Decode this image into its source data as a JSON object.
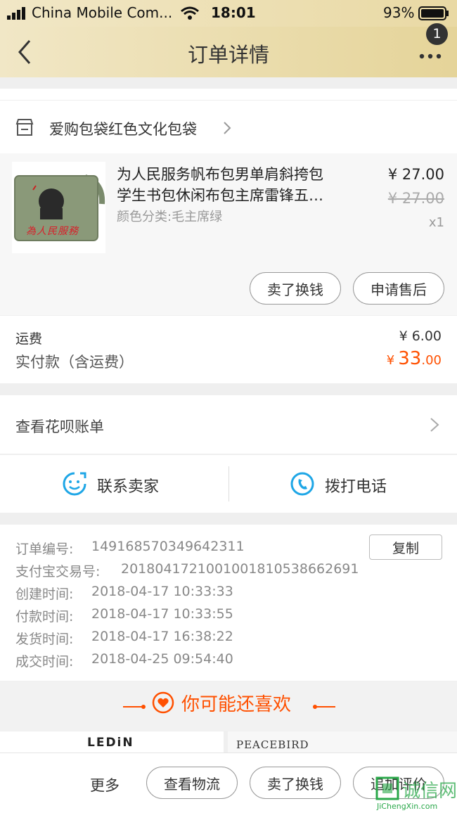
{
  "status": {
    "carrier": "China Mobile Com...",
    "time": "18:01",
    "battery": "93%"
  },
  "nav": {
    "title": "订单详情",
    "badge": "1"
  },
  "shop": {
    "name": "爱购包袋红色文化包袋"
  },
  "product": {
    "title_line1": "为人民服务帆布包男单肩斜挎包",
    "title_line2": "学生书包休闲布包主席雷锋五…",
    "spec": "颜色分类:毛主席绿",
    "price": "¥ 27.00",
    "original_price": "¥ 27.00",
    "quantity": "x1",
    "image_text": "為人民服務",
    "actions": [
      "卖了换钱",
      "申请售后"
    ]
  },
  "payment": {
    "shipping_label": "运费",
    "shipping_value": "¥ 6.00",
    "total_label": "实付款（含运费）",
    "total_currency": "¥",
    "total_int": "33",
    "total_dec": ".00"
  },
  "huabei": {
    "label": "查看花呗账单"
  },
  "contact": {
    "seller": "联系卖家",
    "phone": "拨打电话"
  },
  "order_info": {
    "copy_button": "复制",
    "rows": [
      {
        "label": "订单编号:",
        "value": "149168570349642311"
      },
      {
        "label": "支付宝交易号:",
        "value": "2018041721001001810538662691"
      },
      {
        "label": "创建时间:",
        "value": "2018-04-17 10:33:33"
      },
      {
        "label": "付款时间:",
        "value": "2018-04-17 10:33:55"
      },
      {
        "label": "发货时间:",
        "value": "2018-04-17 16:38:22"
      },
      {
        "label": "成交时间:",
        "value": "2018-04-25 09:54:40"
      }
    ]
  },
  "recommend": {
    "title": "你可能还喜欢",
    "brands": [
      "LEDiN",
      "PEACEBIRD"
    ]
  },
  "bottom": {
    "more": "更多",
    "buttons": [
      "查看物流",
      "卖了换钱",
      "追加评价"
    ]
  },
  "watermark": {
    "text": "诚信网",
    "url": "JiChengXin.com"
  },
  "colors": {
    "accent": "#ff5000",
    "gold": "#e9d9a4",
    "sky": "#1ea6e6"
  }
}
